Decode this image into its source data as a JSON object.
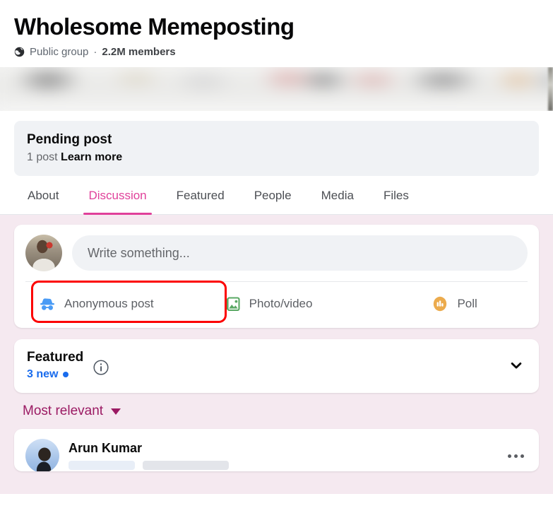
{
  "header": {
    "group_name": "Wholesome Memeposting",
    "privacy_icon": "globe-icon",
    "privacy": "Public group",
    "separator": "·",
    "members": "2.2M members"
  },
  "cover": {
    "alt": "blurred group cover photo"
  },
  "pending": {
    "title": "Pending post",
    "count_text": "1 post",
    "learn_more": "Learn more"
  },
  "tabs": [
    {
      "label": "About",
      "active": false
    },
    {
      "label": "Discussion",
      "active": true
    },
    {
      "label": "Featured",
      "active": false
    },
    {
      "label": "People",
      "active": false
    },
    {
      "label": "Media",
      "active": false
    },
    {
      "label": "Files",
      "active": false
    }
  ],
  "composer": {
    "avatar_name": "user-avatar",
    "placeholder": "Write something...",
    "value": "",
    "actions": [
      {
        "label": "Anonymous post",
        "icon": "incognito-icon",
        "highlighted": true
      },
      {
        "label": "Photo/video",
        "icon": "photo-video-icon",
        "highlighted": false
      },
      {
        "label": "Poll",
        "icon": "poll-icon",
        "highlighted": false
      }
    ]
  },
  "featured": {
    "title": "Featured",
    "new_label": "3 new",
    "info_icon": "info-icon",
    "chevron_icon": "chevron-down-icon"
  },
  "sort": {
    "label": "Most relevant",
    "caret_icon": "caret-down-icon"
  },
  "post": {
    "author": "Arun Kumar",
    "more_icon": "more-options-icon"
  },
  "colors": {
    "accent_pink": "#e0409a",
    "sort_maroon": "#9b1a63",
    "link_blue": "#1a6ced",
    "highlight_red": "#fc0000",
    "feed_bg": "#f5e9f0",
    "card_bg": "#ffffff",
    "muted_text": "#65676b"
  }
}
